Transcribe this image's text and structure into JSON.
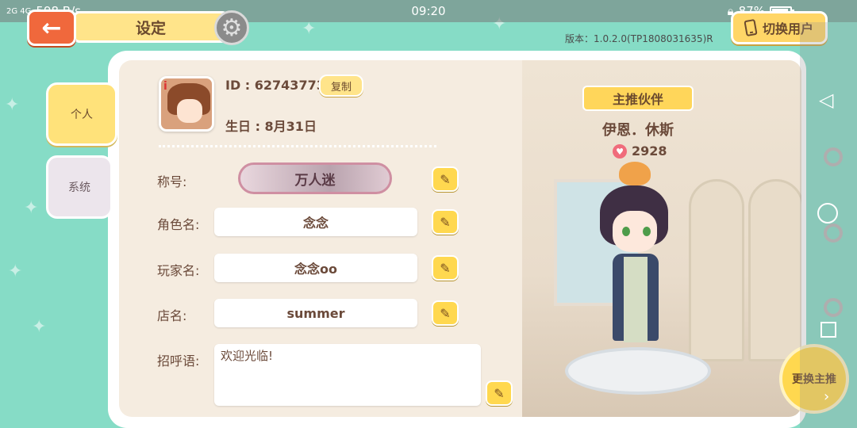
{
  "statusbar": {
    "signal": "2G 4G",
    "speed": "598 B/s",
    "time": "09:20",
    "battery": "87%"
  },
  "header": {
    "title": "设定",
    "version": "版本：1.0.2.0(TP1808031635)R",
    "switch_user": "切换用户"
  },
  "tabs": {
    "personal": "个人",
    "system": "系统"
  },
  "profile": {
    "id": "ID : 62743773",
    "copy": "复制",
    "birthday": "生日 : 8月31日"
  },
  "form": {
    "title_label": "称号:",
    "title_value": "万人迷",
    "role_label": "角色名:",
    "role_value": "念念",
    "player_label": "玩家名:",
    "player_value": "念念oo",
    "shop_label": "店名:",
    "shop_value": "summer",
    "greeting_label": "招呼语:",
    "greeting_value": "欢迎光临!"
  },
  "partner": {
    "ribbon": "主推伙伴",
    "name": "伊恩．休斯",
    "affection": "2928",
    "change": "更换主推"
  },
  "colors": {
    "bg": "#86dcc6",
    "accent": "#ffd84f",
    "back": "#f0683c"
  }
}
